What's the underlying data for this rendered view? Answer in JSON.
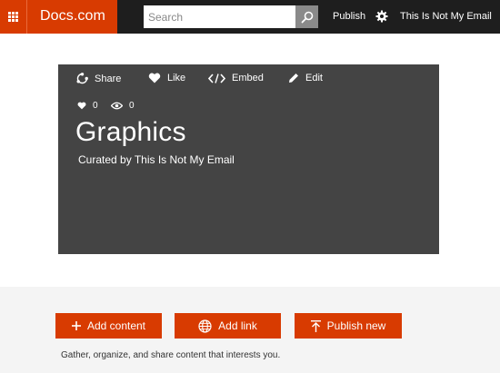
{
  "header": {
    "brand": "Docs.com",
    "search_placeholder": "Search",
    "publish_label": "Publish",
    "user_name": "This Is Not My Email",
    "brand_color": "#d83b01"
  },
  "card": {
    "actions": {
      "share": "Share",
      "like": "Like",
      "embed": "Embed",
      "edit": "Edit"
    },
    "likes": "0",
    "views": "0",
    "title": "Graphics",
    "curated_by": "Curated by This Is Not My Email",
    "background": "#444444"
  },
  "bottom": {
    "add_content": "Add content",
    "add_link": "Add link",
    "publish_new": "Publish new",
    "tagline": "Gather, organize, and share content that interests you."
  },
  "icons": [
    "waffle-icon",
    "search-icon",
    "gear-icon",
    "share-icon",
    "heart-icon",
    "code-icon",
    "pencil-icon",
    "eye-icon",
    "plus-icon",
    "globe-icon",
    "upload-icon"
  ]
}
